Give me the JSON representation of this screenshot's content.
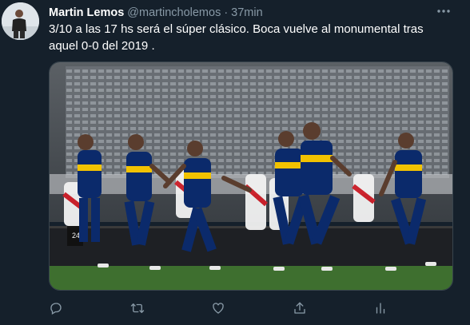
{
  "tweet": {
    "author_name": "Martin Lemos",
    "handle": "@martincholemos",
    "separator": "·",
    "time": "37min",
    "text": "3/10 a las 17 hs será el súper clásico. Boca vuelve al monumental tras aquel 0-0 del 2019 .",
    "more_icon": "more-horizontal-icon",
    "photo": {
      "description_icon": "football-celebration-photo",
      "jersey_number": "24"
    },
    "actions": [
      {
        "name": "reply-icon"
      },
      {
        "name": "retweet-icon"
      },
      {
        "name": "like-icon"
      },
      {
        "name": "share-icon"
      },
      {
        "name": "analytics-icon"
      }
    ]
  },
  "colors": {
    "background": "#15202b",
    "text": "#ffffff",
    "secondary": "#8899a6",
    "boca_blue": "#0b2a6b",
    "boca_gold": "#f2c200"
  }
}
